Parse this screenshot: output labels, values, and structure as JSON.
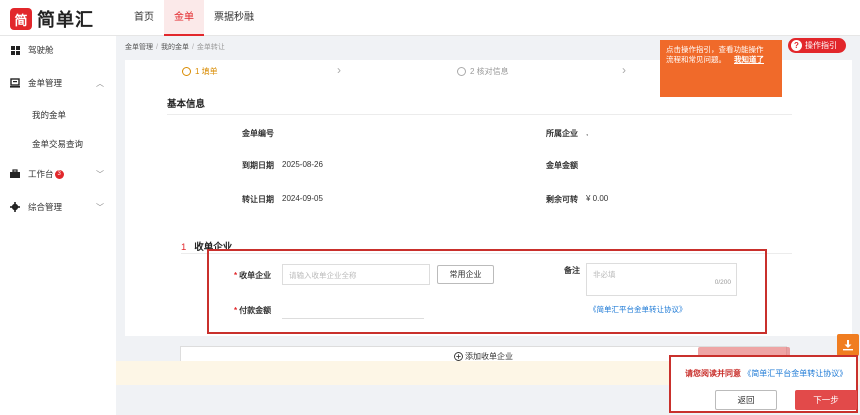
{
  "app": {
    "logo_text": "简单汇",
    "logo_mark": "简"
  },
  "topnav": [
    {
      "label": "首页"
    },
    {
      "label": "金单"
    },
    {
      "label": "票据秒融"
    }
  ],
  "sidebar": {
    "items": [
      {
        "label": "驾驶舱",
        "icon": "dashboard-icon"
      },
      {
        "label": "金单管理",
        "icon": "finance-icon"
      },
      {
        "label": "工作台",
        "icon": "workbench-icon",
        "badge": "3"
      },
      {
        "label": "综合管理",
        "icon": "gear-icon"
      }
    ],
    "sub_items": [
      {
        "label": "我的金单"
      },
      {
        "label": "金单交易查询"
      }
    ]
  },
  "breadcrumb": [
    "金单管理",
    "我的金单",
    "金单转让"
  ],
  "steps": [
    {
      "label": "1 填单"
    },
    {
      "label": "2 核对信息"
    }
  ],
  "basic_info": {
    "title": "基本信息",
    "fields": {
      "jindan_no": {
        "label": "金单编号",
        "value": ""
      },
      "company": {
        "label": "所属企业",
        "value": ","
      },
      "due_date": {
        "label": "到期日期",
        "value": "2025-08-26"
      },
      "amount": {
        "label": "金单金额",
        "value": ""
      },
      "transfer_date": {
        "label": "转让日期",
        "value": "2024-09-05"
      },
      "remaining": {
        "label": "剩余可转",
        "value": "¥ 0.00"
      }
    }
  },
  "receiver": {
    "index": "1",
    "title": "收单企业",
    "company_label": "收单企业",
    "company_placeholder": "请输入收单企业全称",
    "common_btn": "常用企业",
    "remark_label": "备注",
    "remark_placeholder": "非必填",
    "remark_count": "0/200",
    "amount_label": "付款金额",
    "protocol_link": "《简单汇平台金单转让协议》",
    "add_label": "添加收单企业"
  },
  "tooltip": {
    "line1": "点击操作指引，查看功能操作",
    "line2": "流程和常见问题。",
    "know": "我知道了"
  },
  "guide": {
    "label": "操作指引"
  },
  "agree": {
    "text": "请您阅读并同意",
    "link": "《简单汇平台金单转让协议》",
    "prev": "返回",
    "next": "下一步"
  }
}
